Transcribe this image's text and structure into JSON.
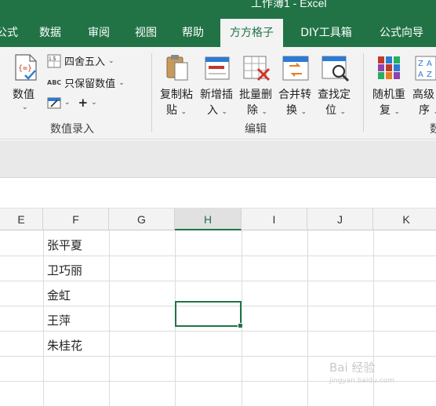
{
  "window": {
    "title": "工作簿1  -  Excel"
  },
  "tabs": [
    "公式",
    "数据",
    "审阅",
    "视图",
    "帮助",
    "方方格子",
    "DIY工具箱",
    "公式向导"
  ],
  "ribbon": {
    "group1": {
      "value_btn": "数值",
      "round_btn": "四舍五入",
      "keep_values_btn": "只保留数值",
      "abc_prefix": "ABC",
      "plus_btn": "+",
      "label": "数值录入"
    },
    "group2": {
      "copy_paste_top": "复制粘",
      "copy_paste_bottom": "贴",
      "insert_top": "新增插",
      "insert_bottom": "入",
      "batch_delete_top": "批量删",
      "batch_delete_bottom": "除",
      "merge_top": "合并转",
      "merge_bottom": "换",
      "find_top": "查找定",
      "find_bottom": "位",
      "label": "编辑"
    },
    "group3": {
      "random_top": "随机重",
      "random_bottom": "复",
      "sort_top": "高级",
      "sort_bottom": "序",
      "label": "数"
    }
  },
  "columns": [
    "E",
    "F",
    "G",
    "H",
    "I",
    "J",
    "K"
  ],
  "cells": {
    "F": [
      "张平夏",
      "卫巧丽",
      "金虹",
      "王萍",
      "朱桂花"
    ]
  },
  "watermark": {
    "main": "Bai 经验",
    "sub": "jingyan.baidu.com"
  }
}
